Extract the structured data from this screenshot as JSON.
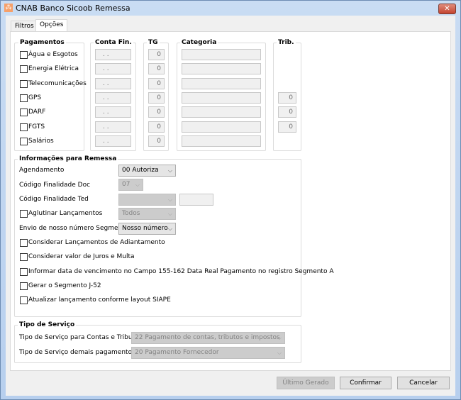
{
  "window": {
    "title": "CNAB Banco Sicoob Remessa",
    "close_glyph": "✕"
  },
  "tabs": [
    {
      "label": "Filtros"
    },
    {
      "label": "Opções"
    }
  ],
  "headers": {
    "pagamentos": "Pagamentos",
    "conta": "Conta Fin.",
    "tg": "TG",
    "categoria": "Categoria",
    "trib": "Trib."
  },
  "pagamentos": [
    {
      "label": "Água e Esgotos",
      "conta": ". .",
      "tg": "0",
      "categoria": "",
      "trib": null
    },
    {
      "label": "Energia Elétrica",
      "conta": ". .",
      "tg": "0",
      "categoria": "",
      "trib": null
    },
    {
      "label": "Telecomunicações",
      "conta": ". .",
      "tg": "0",
      "categoria": "",
      "trib": null
    },
    {
      "label": "GPS",
      "conta": ". .",
      "tg": "0",
      "categoria": "",
      "trib": "0"
    },
    {
      "label": "DARF",
      "conta": ". .",
      "tg": "0",
      "categoria": "",
      "trib": "0"
    },
    {
      "label": "FGTS",
      "conta": ". .",
      "tg": "0",
      "categoria": "",
      "trib": "0"
    },
    {
      "label": "Salários",
      "conta": ". .",
      "tg": "0",
      "categoria": "",
      "trib": null
    }
  ],
  "remessa": {
    "title": "Informações para Remessa",
    "agendamento_label": "Agendamento",
    "agendamento_value": "00 Autoriza",
    "doc_label": "Código Finalidade Doc",
    "doc_value": "07",
    "ted_label": "Código Finalidade Ted",
    "ted_value": "",
    "ted_text": "",
    "aglutinar_label": "Aglutinar Lançamentos",
    "aglutinar_value": "Todos",
    "envio_label": "Envio de nosso número Segmento J",
    "envio_value": "Nosso número",
    "checks": [
      "Considerar Lançamentos de Adiantamento",
      "Considerar valor de Juros e Multa",
      "Informar data de vencimento no Campo 155-162 Data Real Pagamento no registro Segmento A",
      "Gerar o Segmento J-52",
      "Atualizar lançamento conforme layout SIAPE"
    ]
  },
  "servico": {
    "title": "Tipo de Serviço",
    "contas_label": "Tipo de Serviço para Contas e Tributos",
    "contas_value": "22 Pagamento de contas, tributos e impostos",
    "demais_label": "Tipo de Serviço demais pagamentos",
    "demais_value": "20 Pagamento Fornecedor"
  },
  "buttons": {
    "ultimo": "Último Gerado",
    "confirmar": "Confirmar",
    "cancelar": "Cancelar"
  }
}
